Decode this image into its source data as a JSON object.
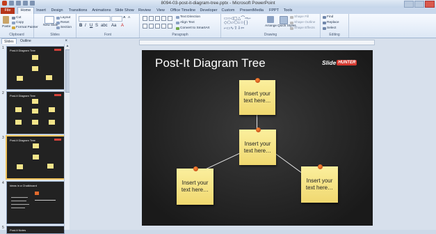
{
  "window": {
    "title": "8094-03-post-it-diagram-tree.pptx - Microsoft PowerPoint"
  },
  "tabs": [
    {
      "label": "File"
    },
    {
      "label": "Home"
    },
    {
      "label": "Insert"
    },
    {
      "label": "Design"
    },
    {
      "label": "Transitions"
    },
    {
      "label": "Animations"
    },
    {
      "label": "Slide Show"
    },
    {
      "label": "Review"
    },
    {
      "label": "View"
    },
    {
      "label": "Office Timeline"
    },
    {
      "label": "Developer"
    },
    {
      "label": "Custom"
    },
    {
      "label": "PresentMedia"
    },
    {
      "label": "FPPT"
    },
    {
      "label": "Tools"
    }
  ],
  "ribbon": {
    "clipboard": {
      "paste": "Paste",
      "cut": "Cut",
      "copy": "Copy",
      "format_painter": "Format Painter",
      "label": "Clipboard"
    },
    "slides": {
      "new_slide": "New Slide",
      "layout": "Layout",
      "reset": "Reset",
      "section": "Section",
      "label": "Slides"
    },
    "font": {
      "label": "Font"
    },
    "paragraph": {
      "text_direction": "Text Direction",
      "align_text": "Align Text",
      "convert_smartart": "Convert to SmartArt",
      "label": "Paragraph"
    },
    "drawing": {
      "arrange": "Arrange",
      "quick_styles": "Quick Styles",
      "shape_fill": "Shape Fill",
      "shape_outline": "Shape Outline",
      "shape_effects": "Shape Effects",
      "label": "Drawing"
    },
    "editing": {
      "find": "Find",
      "replace": "Replace",
      "select": "Select",
      "label": "Editing"
    }
  },
  "pane": {
    "tab_slides": "Slides",
    "tab_outline": "Outline",
    "close": "×"
  },
  "thumbnails": [
    {
      "num": "1",
      "title": "Post-It Diagram Tree"
    },
    {
      "num": "2",
      "title": "Post-It Diagram Tree"
    },
    {
      "num": "3",
      "title": "Post-It Diagram Tree"
    },
    {
      "num": "4",
      "title": "Ideas in a Chalkboard"
    },
    {
      "num": "5",
      "title": "Post-It Notes"
    }
  ],
  "slide": {
    "title": "Post-It Diagram Tree",
    "logo_slide": "Slide",
    "logo_hunter": "HUNTER",
    "notes": [
      {
        "line1": "Insert your",
        "line2": "text here…"
      },
      {
        "line1": "Insert your",
        "line2": "text here…"
      },
      {
        "line1": "Insert your",
        "line2": "text here…"
      },
      {
        "line1": "Insert your",
        "line2": "text here…"
      }
    ]
  }
}
